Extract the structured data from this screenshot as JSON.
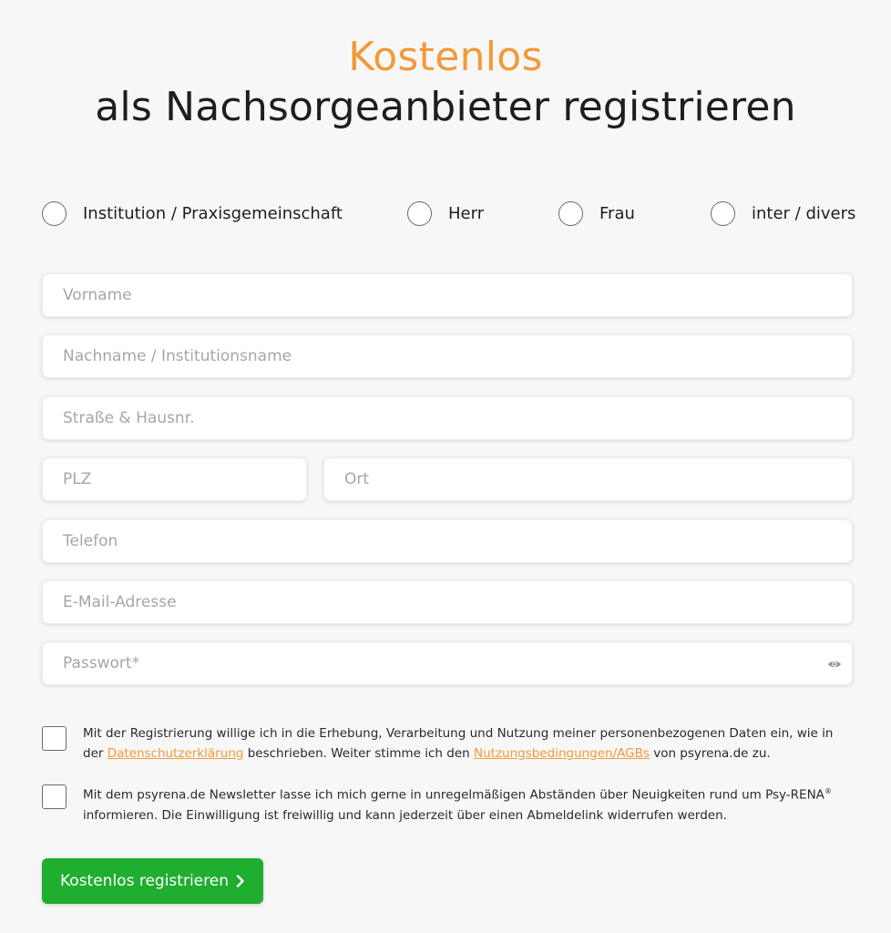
{
  "heading": {
    "line1": "Kostenlos",
    "line2": "als Nachsorgeanbieter registrieren"
  },
  "salutation": {
    "options": [
      "Institution / Praxisgemeinschaft",
      "Herr",
      "Frau",
      "inter / divers"
    ]
  },
  "fields": {
    "firstname": "Vorname",
    "lastname": "Nachname / Institutionsname",
    "street": "Straße & Hausnr.",
    "zip": "PLZ",
    "city": "Ort",
    "phone": "Telefon",
    "email": "E-Mail-Adresse",
    "password": "Passwort*"
  },
  "icons": {
    "password_toggle": "eye-icon",
    "submit_arrow": "chevron-right-icon"
  },
  "consent": {
    "privacy": {
      "text_before": "Mit der Registrierung willige ich in die Erhebung, Verarbeitung und Nutzung meiner personenbezogenen Daten ein, wie in der ",
      "link1": "Datenschutzerklärung",
      "text_middle": " beschrieben. Weiter stimme ich den ",
      "link2": "Nutzungsbedingungen/AGBs",
      "text_after": " von psyrena.de zu."
    },
    "newsletter": {
      "text_before": "Mit dem psyrena.de Newsletter lasse ich mich gerne in unregelmäßigen Abständen über Neuigkeiten rund um Psy-RENA",
      "sup": "®",
      "text_after": " informieren. Die Einwilligung ist freiwillig und kann jederzeit über einen Abmeldelink widerrufen werden."
    }
  },
  "submit": {
    "label": "Kostenlos registrieren"
  },
  "colors": {
    "accent": "#f29a38",
    "primary": "#1fae2f",
    "background": "#f7f7f7"
  }
}
